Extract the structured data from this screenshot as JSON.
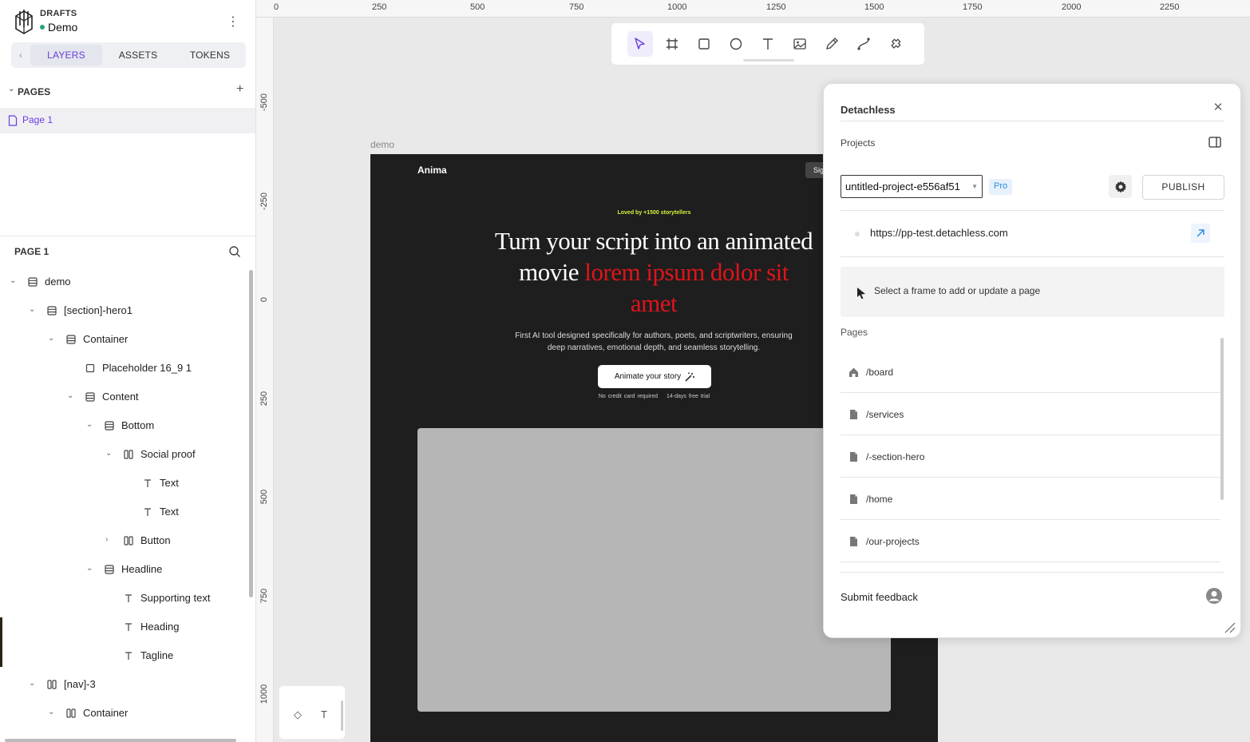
{
  "sidebar": {
    "kicker": "DRAFTS",
    "project_name": "Demo",
    "tabs": [
      {
        "label": "LAYERS",
        "active": true
      },
      {
        "label": "ASSETS",
        "active": false
      },
      {
        "label": "TOKENS",
        "active": false
      }
    ],
    "pages_header": "PAGES",
    "pages": [
      {
        "label": "Page 1",
        "selected": true
      }
    ],
    "layers_header": "PAGE 1",
    "layers": [
      {
        "label": "demo",
        "icon": "stack-layout-icon",
        "depth": 0,
        "expanded": true
      },
      {
        "label": "[section]-hero1",
        "icon": "stack-layout-icon",
        "depth": 1,
        "expanded": true
      },
      {
        "label": "Container",
        "icon": "stack-layout-icon",
        "depth": 2,
        "expanded": true
      },
      {
        "label": "Placeholder 16_9 1",
        "icon": "rectangle-icon",
        "depth": 3,
        "expanded": null
      },
      {
        "label": "Content",
        "icon": "stack-layout-icon",
        "depth": 3,
        "expanded": true
      },
      {
        "label": "Bottom",
        "icon": "stack-layout-icon",
        "depth": 4,
        "expanded": true
      },
      {
        "label": "Social proof",
        "icon": "columns-layout-icon",
        "depth": 5,
        "expanded": true
      },
      {
        "label": "Text",
        "icon": "text-icon",
        "depth": 6,
        "expanded": null
      },
      {
        "label": "Text",
        "icon": "text-icon",
        "depth": 6,
        "expanded": null
      },
      {
        "label": "Button",
        "icon": "columns-layout-icon",
        "depth": 5,
        "expanded": false
      },
      {
        "label": "Headline",
        "icon": "stack-layout-icon",
        "depth": 4,
        "expanded": true
      },
      {
        "label": "Supporting text",
        "icon": "text-icon",
        "depth": 5,
        "expanded": null
      },
      {
        "label": "Heading",
        "icon": "text-icon",
        "depth": 5,
        "expanded": null
      },
      {
        "label": "Tagline",
        "icon": "text-icon",
        "depth": 5,
        "expanded": null
      },
      {
        "label": "[nav]-3",
        "icon": "columns-layout-icon",
        "depth": 1,
        "expanded": true
      },
      {
        "label": "Container",
        "icon": "columns-layout-icon",
        "depth": 2,
        "expanded": true
      }
    ]
  },
  "canvas": {
    "ruler_x": [
      "0",
      "250",
      "500",
      "750",
      "1000",
      "1250",
      "1500",
      "1750",
      "2000",
      "2250"
    ],
    "ruler_y": [
      "-500",
      "-250",
      "0",
      "250",
      "500",
      "750",
      "1000"
    ],
    "toolbar": [
      "move-tool",
      "frame-tool",
      "rectangle-tool",
      "ellipse-tool",
      "text-tool",
      "image-tool",
      "pen-tool",
      "path-tool",
      "plugins-tool"
    ],
    "frame_label": "demo",
    "frame": {
      "brand": "Anima",
      "sign_button": "Sig",
      "tagline": "Loved by +1500 storytellers",
      "heading_white": "Turn your script into an animated movie ",
      "heading_red": "lorem ipsum dolor sit amet",
      "supporting": "First AI tool designed specifically for authors, poets, and scriptwriters, ensuring deep narratives, emotional depth, and seamless storytelling.",
      "cta": "Animate your story",
      "fine_1": "No credit card required",
      "fine_2": "14-days free trial"
    }
  },
  "plugin": {
    "title": "Detachless",
    "projects_label": "Projects",
    "project_select": "untitled-project-e556af51",
    "plan_badge": "Pro",
    "publish_label": "PUBLISH",
    "url": "https://pp-test.detachless.com",
    "info_text": "Select a frame to add or update a page",
    "pages_label": "Pages",
    "pages": [
      {
        "path": "/board",
        "icon": "home-icon"
      },
      {
        "path": "/services",
        "icon": "file-icon"
      },
      {
        "path": "/-section-hero",
        "icon": "file-icon"
      },
      {
        "path": "/home",
        "icon": "file-icon"
      },
      {
        "path": "/our-projects",
        "icon": "file-icon"
      }
    ],
    "feedback_label": "Submit feedback"
  },
  "colors": {
    "accent": "#6a3ee0",
    "highlight_red": "#e0141b",
    "tagline_yellow": "#d8f03a",
    "pro_blue": "#2f8be0"
  }
}
